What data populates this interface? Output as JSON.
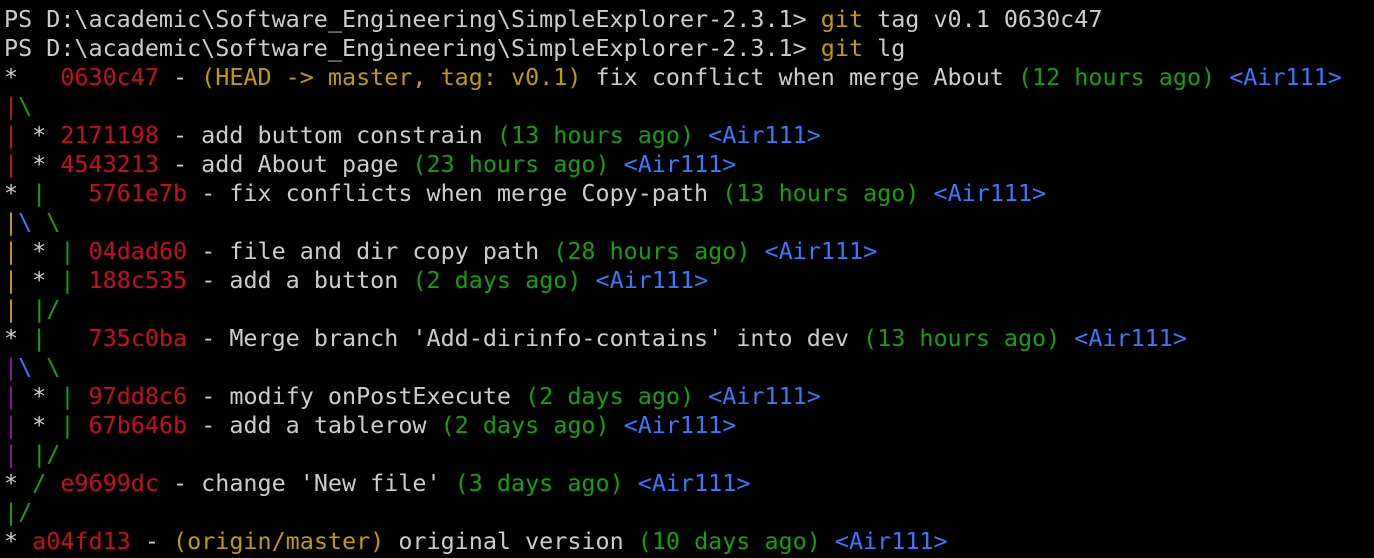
{
  "terminal": {
    "background": "#000000",
    "default_color": "#cccccc",
    "palette": {
      "white": "#cccccc",
      "red": "#c50f1f",
      "green": "#13a10e",
      "yellow": "#c19c00",
      "blue": "#3b78ff",
      "purple": "#881798"
    },
    "lines": [
      {
        "kind": "prompt",
        "segs": [
          {
            "t": "PS D:\\academic\\Software_Engineering\\SimpleExplorer-2.3.1> ",
            "c": "white"
          },
          {
            "t": "git",
            "c": "yellow"
          },
          {
            "t": " tag v0.1 0630c47",
            "c": "white"
          }
        ]
      },
      {
        "kind": "prompt",
        "segs": [
          {
            "t": "PS D:\\academic\\Software_Engineering\\SimpleExplorer-2.3.1> ",
            "c": "white"
          },
          {
            "t": "git",
            "c": "yellow"
          },
          {
            "t": " lg",
            "c": "white"
          }
        ]
      },
      {
        "kind": "commit",
        "segs": [
          {
            "t": "*   ",
            "c": "white"
          },
          {
            "t": "0630c47",
            "c": "red"
          },
          {
            "t": " - ",
            "c": "white"
          },
          {
            "t": "(HEAD -> master, tag: v0.1)",
            "c": "yellow"
          },
          {
            "t": " fix conflict when merge About ",
            "c": "white"
          },
          {
            "t": "(12 hours ago)",
            "c": "green"
          },
          {
            "t": " ",
            "c": "white"
          },
          {
            "t": "<Air111>",
            "c": "blue"
          }
        ]
      },
      {
        "kind": "graph",
        "segs": [
          {
            "t": "|",
            "c": "red"
          },
          {
            "t": "\\",
            "c": "green"
          }
        ]
      },
      {
        "kind": "commit",
        "segs": [
          {
            "t": "|",
            "c": "red"
          },
          {
            "t": " * ",
            "c": "white"
          },
          {
            "t": "2171198",
            "c": "red"
          },
          {
            "t": " - add buttom constrain ",
            "c": "white"
          },
          {
            "t": "(13 hours ago)",
            "c": "green"
          },
          {
            "t": " ",
            "c": "white"
          },
          {
            "t": "<Air111>",
            "c": "blue"
          }
        ]
      },
      {
        "kind": "commit",
        "segs": [
          {
            "t": "|",
            "c": "red"
          },
          {
            "t": " * ",
            "c": "white"
          },
          {
            "t": "4543213",
            "c": "red"
          },
          {
            "t": " - add About page ",
            "c": "white"
          },
          {
            "t": "(23 hours ago)",
            "c": "green"
          },
          {
            "t": " ",
            "c": "white"
          },
          {
            "t": "<Air111>",
            "c": "blue"
          }
        ]
      },
      {
        "kind": "commit",
        "segs": [
          {
            "t": "* ",
            "c": "white"
          },
          {
            "t": "|",
            "c": "green"
          },
          {
            "t": "   ",
            "c": "white"
          },
          {
            "t": "5761e7b",
            "c": "red"
          },
          {
            "t": " - fix conflicts when merge Copy-path ",
            "c": "white"
          },
          {
            "t": "(13 hours ago)",
            "c": "green"
          },
          {
            "t": " ",
            "c": "white"
          },
          {
            "t": "<Air111>",
            "c": "blue"
          }
        ]
      },
      {
        "kind": "graph",
        "segs": [
          {
            "t": "|",
            "c": "yellow"
          },
          {
            "t": "\\",
            "c": "blue"
          },
          {
            "t": " ",
            "c": "white"
          },
          {
            "t": "\\",
            "c": "green"
          }
        ]
      },
      {
        "kind": "commit",
        "segs": [
          {
            "t": "|",
            "c": "yellow"
          },
          {
            "t": " * ",
            "c": "white"
          },
          {
            "t": "|",
            "c": "green"
          },
          {
            "t": " ",
            "c": "white"
          },
          {
            "t": "04dad60",
            "c": "red"
          },
          {
            "t": " - file and dir copy path ",
            "c": "white"
          },
          {
            "t": "(28 hours ago)",
            "c": "green"
          },
          {
            "t": " ",
            "c": "white"
          },
          {
            "t": "<Air111>",
            "c": "blue"
          }
        ]
      },
      {
        "kind": "commit",
        "segs": [
          {
            "t": "|",
            "c": "yellow"
          },
          {
            "t": " * ",
            "c": "white"
          },
          {
            "t": "|",
            "c": "green"
          },
          {
            "t": " ",
            "c": "white"
          },
          {
            "t": "188c535",
            "c": "red"
          },
          {
            "t": " - add a button ",
            "c": "white"
          },
          {
            "t": "(2 days ago)",
            "c": "green"
          },
          {
            "t": " ",
            "c": "white"
          },
          {
            "t": "<Air111>",
            "c": "blue"
          }
        ]
      },
      {
        "kind": "graph",
        "segs": [
          {
            "t": "|",
            "c": "yellow"
          },
          {
            "t": " ",
            "c": "white"
          },
          {
            "t": "|/",
            "c": "green"
          }
        ]
      },
      {
        "kind": "commit",
        "segs": [
          {
            "t": "* ",
            "c": "white"
          },
          {
            "t": "|",
            "c": "green"
          },
          {
            "t": "   ",
            "c": "white"
          },
          {
            "t": "735c0ba",
            "c": "red"
          },
          {
            "t": " - Merge branch 'Add-dirinfo-contains' into dev ",
            "c": "white"
          },
          {
            "t": "(13 hours ago)",
            "c": "green"
          },
          {
            "t": " ",
            "c": "white"
          },
          {
            "t": "<Air111>",
            "c": "blue"
          }
        ]
      },
      {
        "kind": "graph",
        "segs": [
          {
            "t": "|",
            "c": "purple"
          },
          {
            "t": "\\",
            "c": "blue"
          },
          {
            "t": " ",
            "c": "white"
          },
          {
            "t": "\\",
            "c": "green"
          }
        ]
      },
      {
        "kind": "commit",
        "segs": [
          {
            "t": "|",
            "c": "purple"
          },
          {
            "t": " * ",
            "c": "white"
          },
          {
            "t": "|",
            "c": "green"
          },
          {
            "t": " ",
            "c": "white"
          },
          {
            "t": "97dd8c6",
            "c": "red"
          },
          {
            "t": " - modify onPostExecute ",
            "c": "white"
          },
          {
            "t": "(2 days ago)",
            "c": "green"
          },
          {
            "t": " ",
            "c": "white"
          },
          {
            "t": "<Air111>",
            "c": "blue"
          }
        ]
      },
      {
        "kind": "commit",
        "segs": [
          {
            "t": "|",
            "c": "purple"
          },
          {
            "t": " * ",
            "c": "white"
          },
          {
            "t": "|",
            "c": "green"
          },
          {
            "t": " ",
            "c": "white"
          },
          {
            "t": "67b646b",
            "c": "red"
          },
          {
            "t": " - add a tablerow ",
            "c": "white"
          },
          {
            "t": "(2 days ago)",
            "c": "green"
          },
          {
            "t": " ",
            "c": "white"
          },
          {
            "t": "<Air111>",
            "c": "blue"
          }
        ]
      },
      {
        "kind": "graph",
        "segs": [
          {
            "t": "|",
            "c": "purple"
          },
          {
            "t": " ",
            "c": "white"
          },
          {
            "t": "|/",
            "c": "green"
          }
        ]
      },
      {
        "kind": "commit",
        "segs": [
          {
            "t": "* ",
            "c": "white"
          },
          {
            "t": "/",
            "c": "green"
          },
          {
            "t": " ",
            "c": "white"
          },
          {
            "t": "e9699dc",
            "c": "red"
          },
          {
            "t": " - change 'New file' ",
            "c": "white"
          },
          {
            "t": "(3 days ago)",
            "c": "green"
          },
          {
            "t": " ",
            "c": "white"
          },
          {
            "t": "<Air111>",
            "c": "blue"
          }
        ]
      },
      {
        "kind": "graph",
        "segs": [
          {
            "t": "|/",
            "c": "green"
          }
        ]
      },
      {
        "kind": "commit",
        "segs": [
          {
            "t": "* ",
            "c": "white"
          },
          {
            "t": "a04fd13",
            "c": "red"
          },
          {
            "t": " - ",
            "c": "white"
          },
          {
            "t": "(origin/master)",
            "c": "yellow"
          },
          {
            "t": " original version ",
            "c": "white"
          },
          {
            "t": "(10 days ago)",
            "c": "green"
          },
          {
            "t": " ",
            "c": "white"
          },
          {
            "t": "<Air111>",
            "c": "blue"
          }
        ]
      }
    ]
  }
}
